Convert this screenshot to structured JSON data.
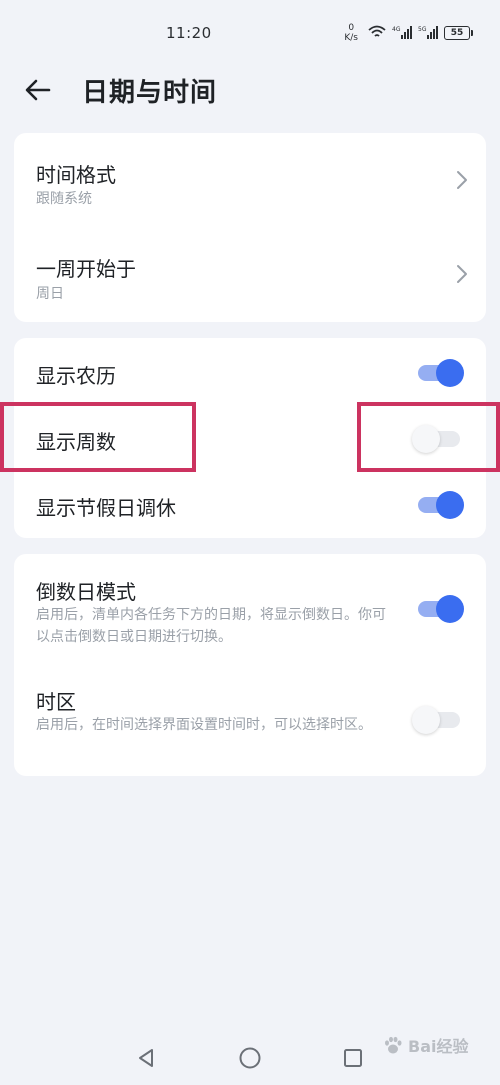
{
  "status_bar": {
    "time": "11:20",
    "net_speed_value": "0",
    "net_speed_unit": "K/s",
    "battery": "55"
  },
  "app_bar": {
    "title": "日期与时间"
  },
  "card_format": {
    "time_format": {
      "title": "时间格式",
      "value": "跟随系统"
    },
    "week_start": {
      "title": "一周开始于",
      "value": "周日"
    }
  },
  "card_display": {
    "lunar": {
      "title": "显示农历",
      "enabled": true
    },
    "week_number": {
      "title": "显示周数",
      "enabled": false
    },
    "holiday": {
      "title": "显示节假日调休",
      "enabled": true
    }
  },
  "card_modes": {
    "countdown": {
      "title": "倒数日模式",
      "description": "启用后，清单内各任务下方的日期，将显示倒数日。你可以点击倒数日或日期进行切换。",
      "enabled": true
    },
    "timezone": {
      "title": "时区",
      "description": "启用后，在时间选择界面设置时间时，可以选择时区。",
      "enabled": false
    }
  },
  "colors": {
    "accent": "#3a6df0",
    "highlight": "#cc3360",
    "background": "#f1f3f8"
  }
}
